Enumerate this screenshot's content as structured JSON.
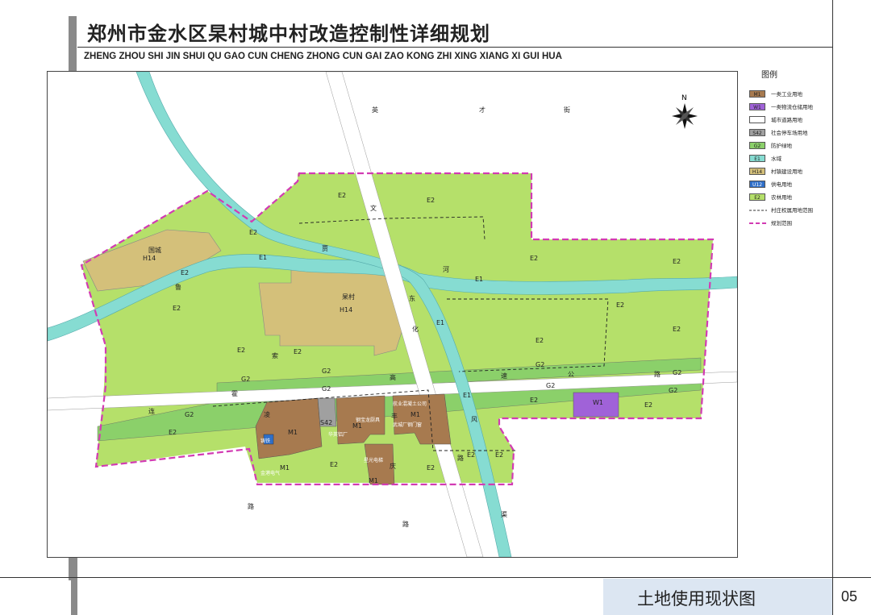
{
  "header": {
    "title_cn": "郑州市金水区杲村城中村改造控制性详细规划",
    "title_en": "ZHENG ZHOU SHI JIN SHUI QU GAO CUN CHENG ZHONG CUN GAI ZAO KONG ZHI XING XIANG XI GUI HUA"
  },
  "footer": {
    "title": "土地使用现状图",
    "page_number": "05"
  },
  "legend": {
    "title": "图例",
    "items": [
      {
        "code": "M1",
        "label": "一类工业用地",
        "color": "#a77a4f"
      },
      {
        "code": "W1",
        "label": "一类物流仓储用地",
        "color": "#a062d8"
      },
      {
        "code": "",
        "label": "城市道路用地",
        "color": "#ffffff"
      },
      {
        "code": "S42",
        "label": "社会停车场用地",
        "color": "#a0a0a0"
      },
      {
        "code": "G2",
        "label": "防护绿地",
        "color": "#8bd06a"
      },
      {
        "code": "E1",
        "label": "水域",
        "color": "#86dcd2"
      },
      {
        "code": "H14",
        "label": "村镇建设用地",
        "color": "#d4c07a"
      },
      {
        "code": "U12",
        "label": "供电用地",
        "color": "#2f6fc9"
      },
      {
        "code": "E2",
        "label": "农林用地",
        "color": "#b5e06a"
      },
      {
        "code": "",
        "label": "村庄权属用地范围",
        "color": "#333333"
      },
      {
        "code": "",
        "label": "规划范围",
        "color": "#d23bb3"
      }
    ]
  },
  "map": {
    "north_label": "N",
    "colors": {
      "farmland": "#b5e06a",
      "greenbelt": "#8bd06a",
      "water": "#86dcd2",
      "village": "#d4c07a",
      "industrial": "#a77a4f",
      "logistics": "#a062d8",
      "parking": "#a0a0a0",
      "power": "#2f6fc9",
      "boundary": "#d23bb3"
    },
    "labels": {
      "e2": "E2",
      "e1": "E1",
      "g2": "G2",
      "h14": "H14",
      "m1": "M1",
      "w1": "W1",
      "s42": "S42",
      "u12": "U12",
      "village_gaocun": "杲村",
      "village_guocheng": "国城",
      "road_yingcai_1": "英",
      "road_yingcai_2": "才",
      "road_yingcai_3": "街",
      "road_wenhua_1": "文",
      "road_wenhua_2": "化",
      "road_wenhua_3": "路",
      "road_dongfeng_1": "东",
      "road_dongfeng_2": "风",
      "road_dongfeng_3": "渠",
      "road_gaosu_1": "高",
      "road_gaosu_2": "速",
      "road_gaosu_3": "公",
      "road_gaosu_4": "路",
      "river_1": "贾",
      "river_2": "鲁",
      "river_3": "河",
      "road_lian": "连",
      "road_huo": "霍",
      "road_suolingroad_1": "索",
      "road_suolingroad_2": "凌",
      "road_suolingroad_3": "路",
      "road_fengqing_1": "丰",
      "road_fengqing_2": "庆",
      "road_fengqing_3": "路",
      "factory_1": "华英铝厂",
      "factory_2": "钢宝龙厨具",
      "factory_3": "航业混凝土公司",
      "factory_4": "武城厂钢门窗",
      "factory_5": "星光电梯",
      "factory_6": "金港电气",
      "factory_7": "铸铁"
    }
  }
}
